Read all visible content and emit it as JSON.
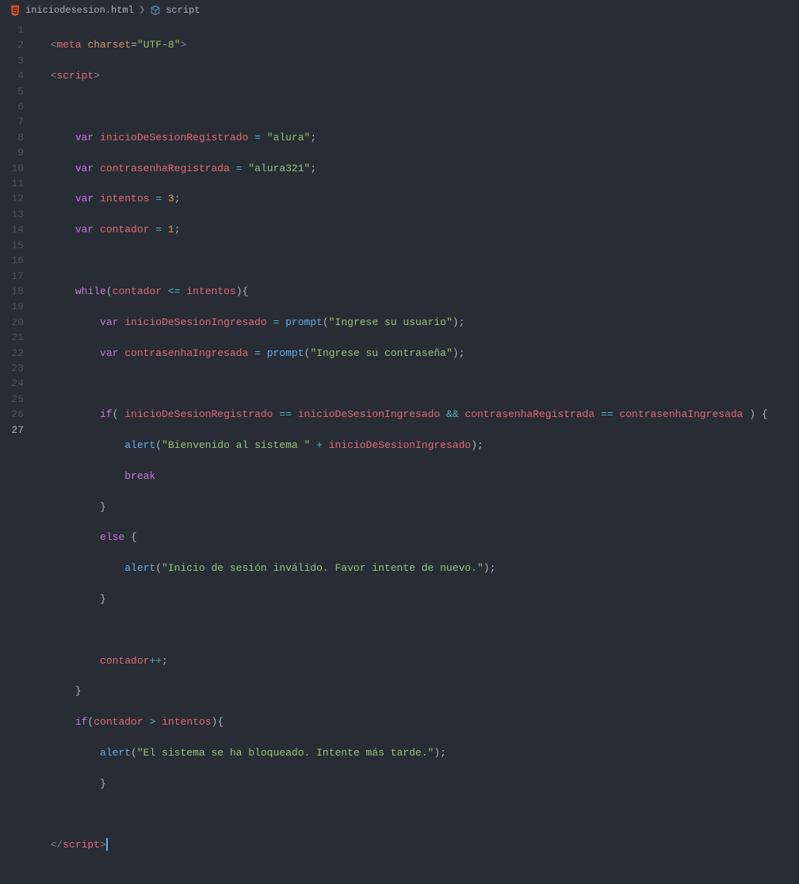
{
  "breadcrumb": {
    "file": "iniciodesesion.html",
    "symbol": "script"
  },
  "lines": [
    1,
    2,
    3,
    4,
    5,
    6,
    7,
    8,
    9,
    10,
    11,
    12,
    13,
    14,
    15,
    16,
    17,
    18,
    19,
    20,
    21,
    22,
    23,
    24,
    25,
    26,
    27
  ],
  "activeLine": 27,
  "code": {
    "l1": {
      "tag_open": "<",
      "tag": "meta",
      "attr": "charset",
      "eq": "=",
      "q1": "\"",
      "val": "UTF-8",
      "q2": "\"",
      "tag_close": ">"
    },
    "l2": {
      "open": "<",
      "tag": "script",
      "close": ">"
    },
    "l4": {
      "kw": "var",
      "name": "inicioDeSesionRegistrado",
      "op": "=",
      "q1": "\"",
      "str": "alura",
      "q2": "\"",
      "semi": ";"
    },
    "l5": {
      "kw": "var",
      "name": "contrasenhaRegistrada",
      "op": "=",
      "q1": "\"",
      "str": "alura321",
      "q2": "\"",
      "semi": ";"
    },
    "l6": {
      "kw": "var",
      "name": "intentos",
      "op": "=",
      "num": "3",
      "semi": ";"
    },
    "l7": {
      "kw": "var",
      "name": "contador",
      "op": "=",
      "num": "1",
      "semi": ";"
    },
    "l9": {
      "kw": "while",
      "p1": "(",
      "v1": "contador",
      "op": "<=",
      "v2": "intentos",
      "p2": ")",
      "brace": "{"
    },
    "l10": {
      "kw": "var",
      "name": "inicioDeSesionIngresado",
      "op": "=",
      "fn": "prompt",
      "p1": "(",
      "q1": "\"",
      "str": "Ingrese su usuario",
      "q2": "\"",
      "p2": ")",
      "semi": ";"
    },
    "l11": {
      "kw": "var",
      "name": "contrasenhaIngresada",
      "op": "=",
      "fn": "prompt",
      "p1": "(",
      "q1": "\"",
      "str": "Ingrese su contraseña",
      "q2": "\"",
      "p2": ")",
      "semi": ";"
    },
    "l13": {
      "kw": "if",
      "p1": "(",
      "v1": "inicioDeSesionRegistrado",
      "op1": "==",
      "v2": "inicioDeSesionIngresado",
      "and": "&&",
      "v3": "contrasenhaRegistrada",
      "op2": "==",
      "v4": "contrasenhaIngresada",
      "p2": ")",
      "brace": "{"
    },
    "l14": {
      "fn": "alert",
      "p1": "(",
      "q1": "\"",
      "str": "Bienvenido al sistema ",
      "q2": "\"",
      "plus": "+",
      "v": "inicioDeSesionIngresado",
      "p2": ")",
      "semi": ";"
    },
    "l15": {
      "kw": "break"
    },
    "l16": {
      "brace": "}"
    },
    "l17": {
      "kw": "else",
      "brace": "{"
    },
    "l18": {
      "fn": "alert",
      "p1": "(",
      "q1": "\"",
      "str": "Inicio de sesión inválido. Favor intente de nuevo.",
      "q2": "\"",
      "p2": ")",
      "semi": ";"
    },
    "l19": {
      "brace": "}"
    },
    "l21": {
      "v": "contador",
      "op": "++",
      "semi": ";"
    },
    "l22": {
      "brace": "}"
    },
    "l23": {
      "kw": "if",
      "p1": "(",
      "v1": "contador",
      "op": ">",
      "v2": "intentos",
      "p2": ")",
      "brace": "{"
    },
    "l24": {
      "fn": "alert",
      "p1": "(",
      "q1": "\"",
      "str": "El sistema se ha bloqueado. Intente más tarde.",
      "q2": "\"",
      "p2": ")",
      "semi": ";"
    },
    "l25": {
      "brace": "}"
    },
    "l27": {
      "open": "</",
      "tag": "script",
      "close": ">"
    }
  }
}
